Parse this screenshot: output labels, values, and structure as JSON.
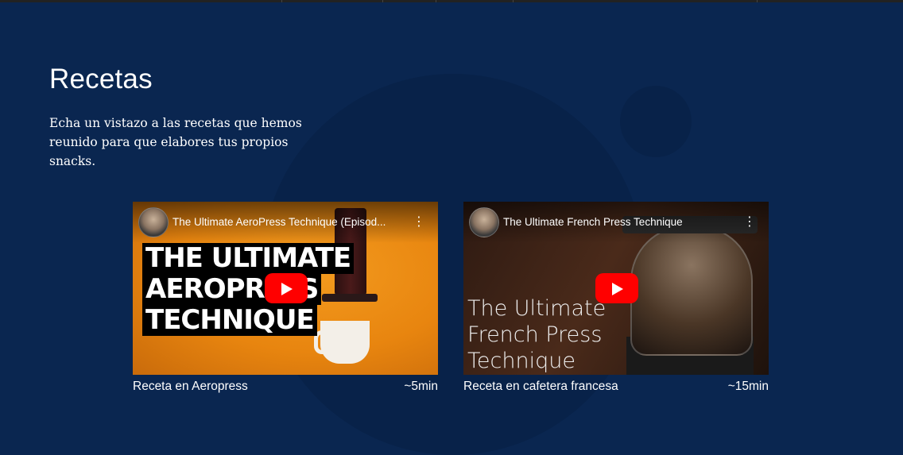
{
  "section": {
    "title": "Recetas",
    "subtitle": "Echa un vistazo a las recetas que hemos reunido para que elabores tus propios snacks."
  },
  "videos": [
    {
      "video_title": "The Ultimate AeroPress Technique (Episod...",
      "thumbnail_text": [
        "THE ULTIMATE",
        "AEROPRESS",
        "TECHNIQUE"
      ],
      "caption": "Receta en Aeropress",
      "duration": "~5min",
      "theme_color": "#e8850f"
    },
    {
      "video_title": "The Ultimate French Press Technique",
      "thumbnail_text": [
        "The Ultimate",
        "French Press",
        "Technique"
      ],
      "caption": "Receta en cafetera francesa",
      "duration": "~15min",
      "theme_color": "#3a2418"
    }
  ],
  "colors": {
    "background": "#0a2650",
    "decor": "#082249",
    "play_button": "#ff0000"
  },
  "icons": {
    "play": "youtube-play-icon",
    "menu": "more-vertical-icon",
    "avatar": "channel-avatar"
  }
}
